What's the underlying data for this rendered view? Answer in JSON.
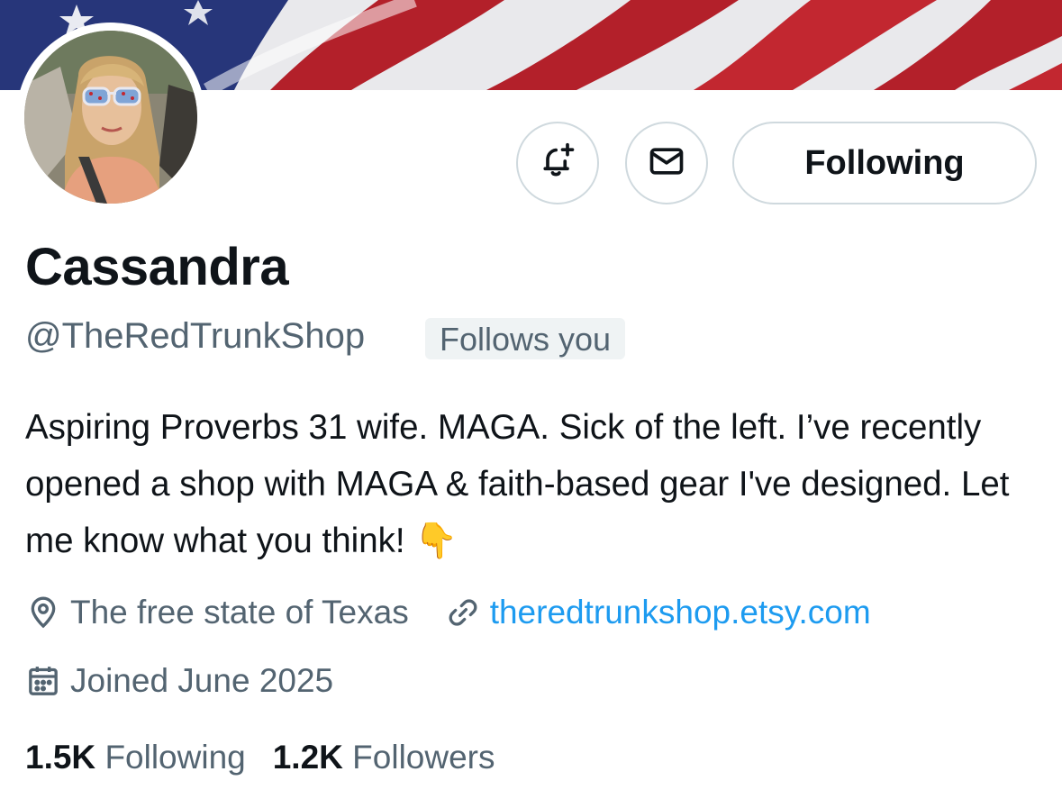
{
  "profile": {
    "display_name": "Cassandra",
    "handle": "@TheRedTrunkShop",
    "follows_you": "Follows you",
    "bio": "Aspiring Proverbs 31 wife. MAGA. Sick of the left. I’ve recently opened a shop with MAGA & faith-based gear I've designed. Let me know what you think! 👇",
    "location": "The free state of Texas",
    "website": "theredtrunkshop.etsy.com",
    "joined": "Joined June 2025"
  },
  "actions": {
    "following_label": "Following",
    "notify_icon": "bell-plus-icon",
    "message_icon": "envelope-icon"
  },
  "stats": {
    "following_count": "1.5K",
    "following_label": "Following",
    "followers_count": "1.2K",
    "followers_label": "Followers"
  },
  "colors": {
    "text_primary": "#0f1419",
    "text_secondary": "#536471",
    "link": "#1d9bf0",
    "border": "#cfd9de",
    "badge_bg": "#eff3f4"
  }
}
